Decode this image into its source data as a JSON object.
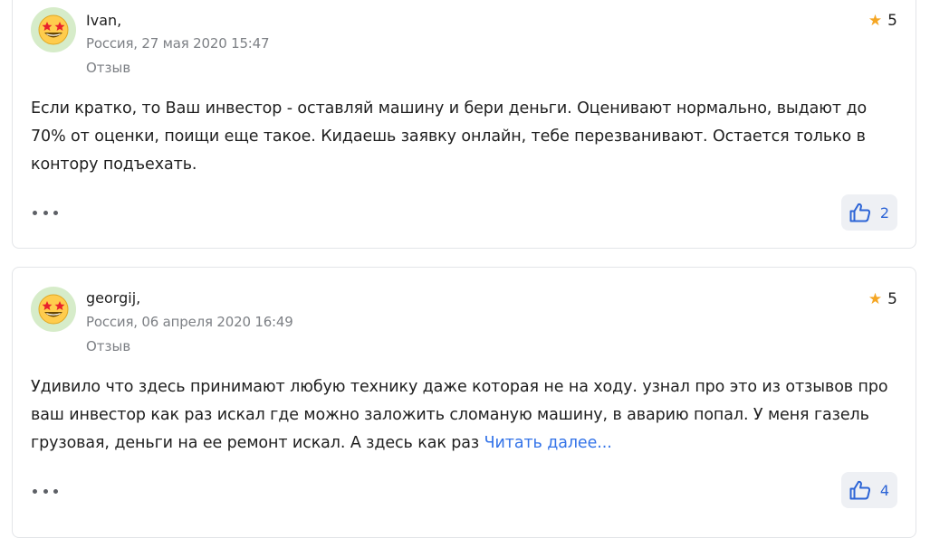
{
  "reviews": [
    {
      "author": "Ivan,",
      "meta": "Россия, 27 мая 2020 15:47",
      "kind": "Отзыв",
      "rating": "5",
      "text": "Если кратко, то Ваш инвестор - оставляй машину и бери деньги. Оценивают нормально, выдают до 70% от оценки, поищи еще такое. Кидаешь заявку онлайн, тебе перезванивают. Остается только в контору подъехать.",
      "read_more": "",
      "likes": "2"
    },
    {
      "author": "georgij,",
      "meta": "Россия, 06 апреля 2020 16:49",
      "kind": "Отзыв",
      "rating": "5",
      "text": "Удивило что здесь принимают любую технику даже которая не на ходу. узнал про это из отзывов про ваш инвестор как раз искал где можно заложить сломаную машину, в аварию попал. У меня газель грузовая, деньги на ее ремонт искал. А здесь как раз ",
      "read_more": "Читать далее...",
      "likes": "4"
    }
  ],
  "icons": {
    "avatar": "star-struck-emoji-icon",
    "rating": "star-icon",
    "more": "more-dots-icon",
    "like": "thumbs-up-icon"
  },
  "colors": {
    "accent": "#3373e8",
    "star": "#f5a623",
    "avatar_bg": "#d6ecc9",
    "like_bg": "#eef0f4"
  }
}
